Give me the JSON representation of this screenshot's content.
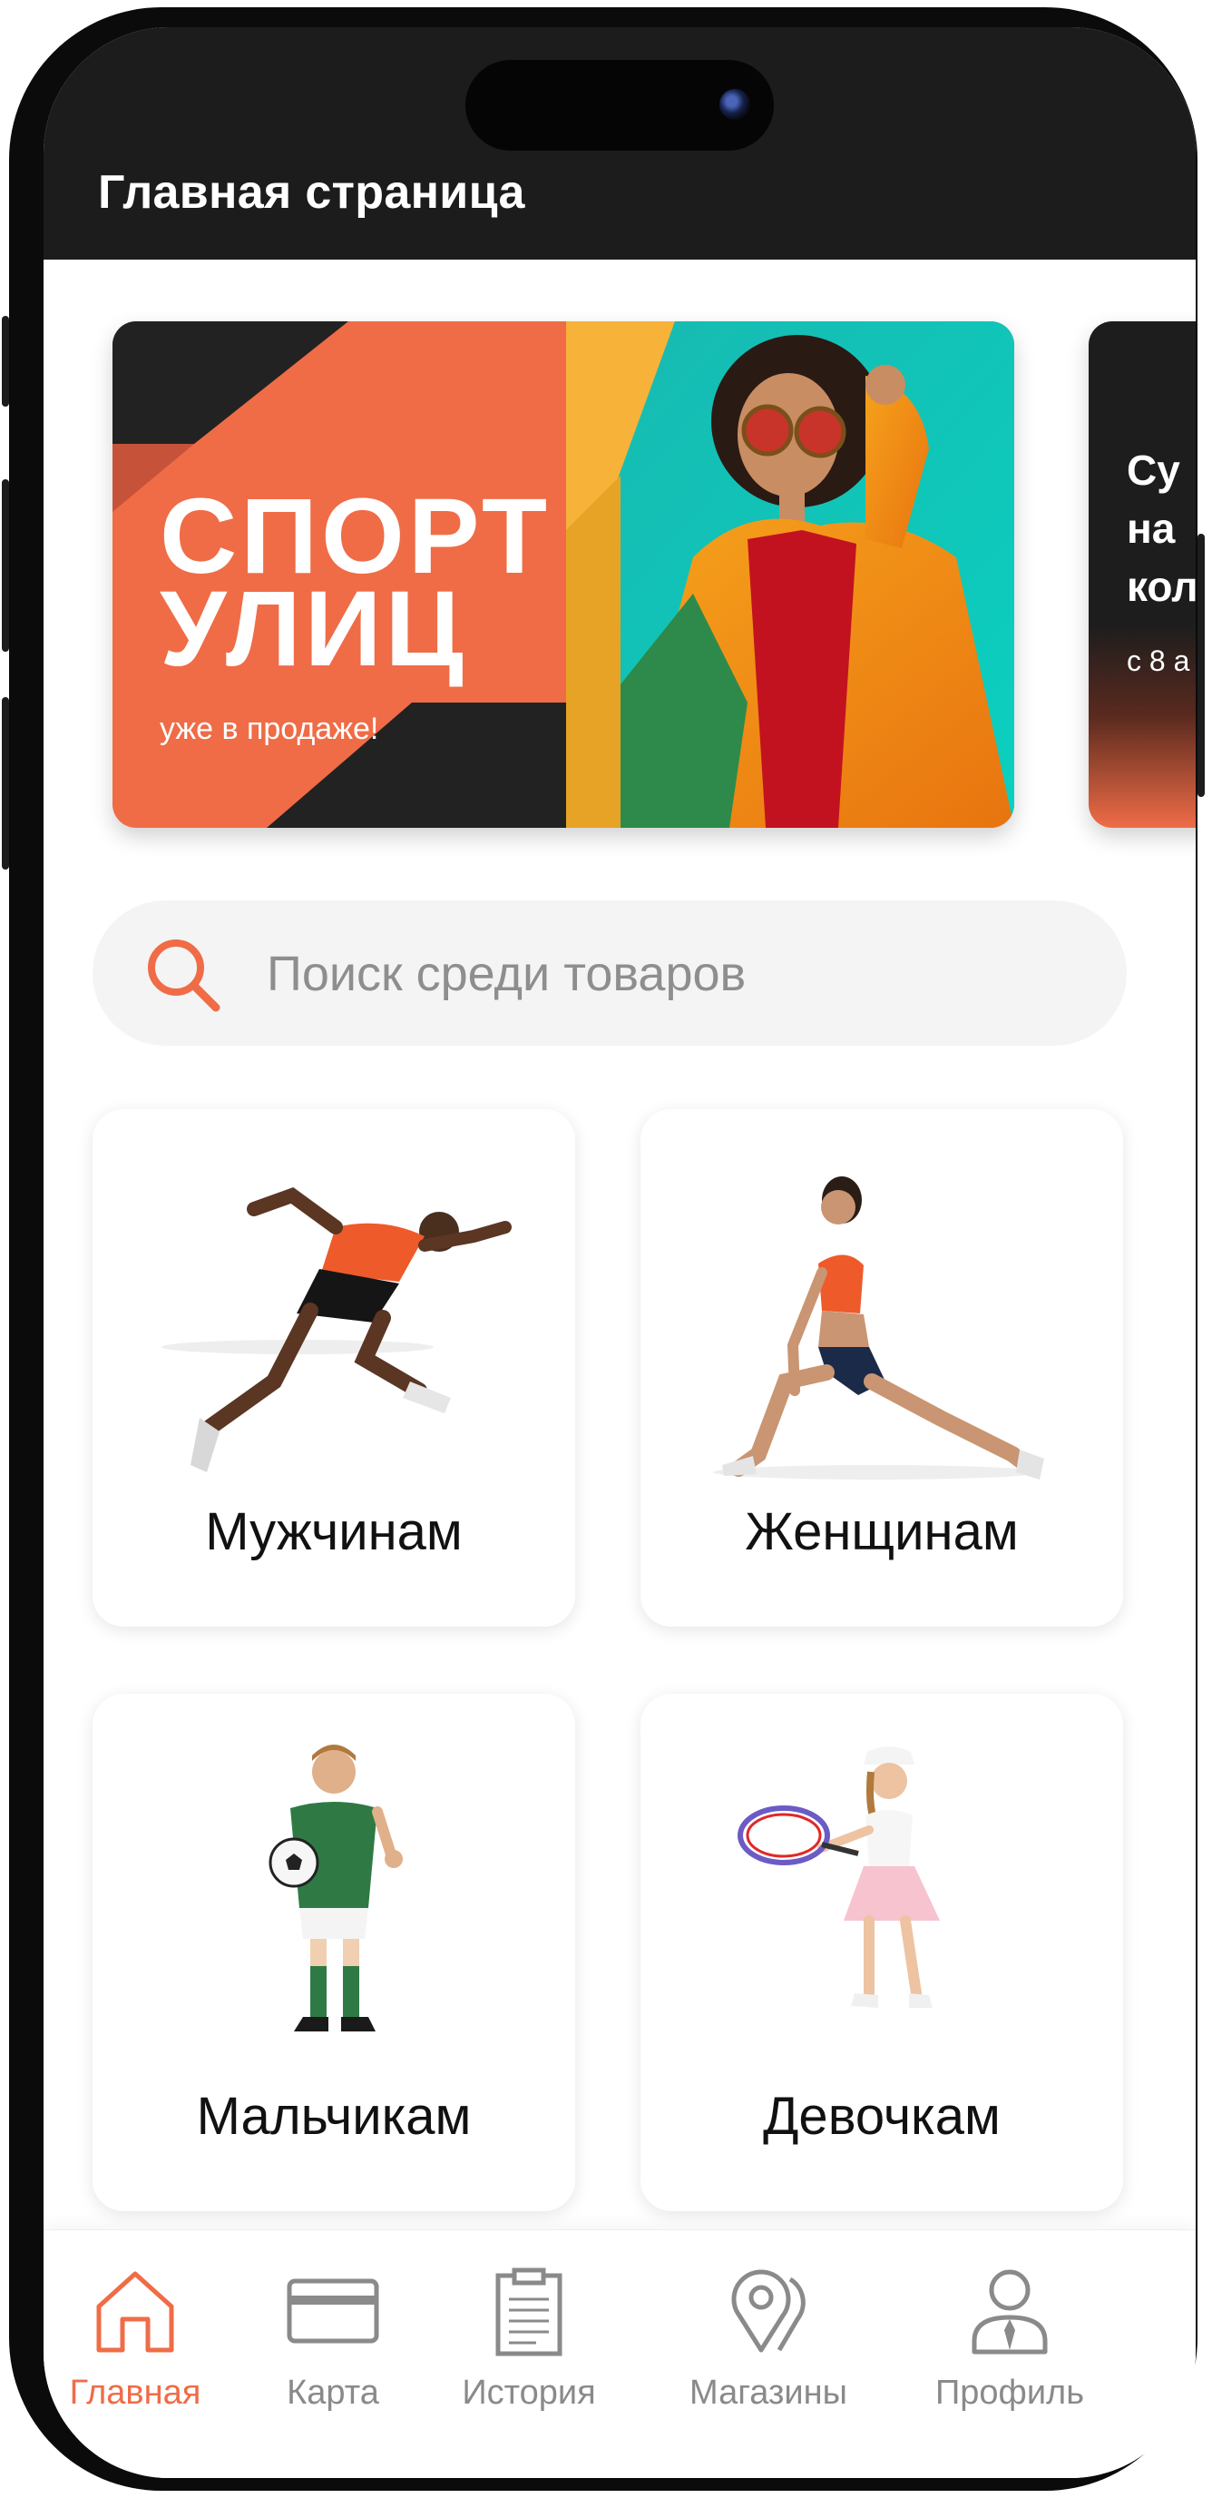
{
  "header": {
    "title": "Главная страница"
  },
  "banners": [
    {
      "title_line1": "СПОРТ",
      "title_line2": "УЛИЦ",
      "subtitle": "уже в продаже!"
    },
    {
      "title": "Су\nна\nкол",
      "subtitle": "с 8 а"
    }
  ],
  "search": {
    "placeholder": "Поиск среди товаров",
    "value": ""
  },
  "categories": [
    {
      "label": "Мужчинам"
    },
    {
      "label": "Женщинам"
    },
    {
      "label": "Мальчикам"
    },
    {
      "label": "Девочкам"
    }
  ],
  "nav": {
    "active": "home",
    "items": [
      {
        "id": "home",
        "label": "Главная",
        "icon": "home-icon"
      },
      {
        "id": "card",
        "label": "Карта",
        "icon": "card-icon"
      },
      {
        "id": "history",
        "label": "История",
        "icon": "clipboard-icon"
      },
      {
        "id": "stores",
        "label": "Магазины",
        "icon": "map-pin-icon"
      },
      {
        "id": "profile",
        "label": "Профиль",
        "icon": "user-icon"
      }
    ]
  },
  "colors": {
    "accent": "#ef6c47",
    "header_bg": "#1c1c1c",
    "inactive": "#8a8a8a",
    "search_bg": "#f4f4f4"
  }
}
